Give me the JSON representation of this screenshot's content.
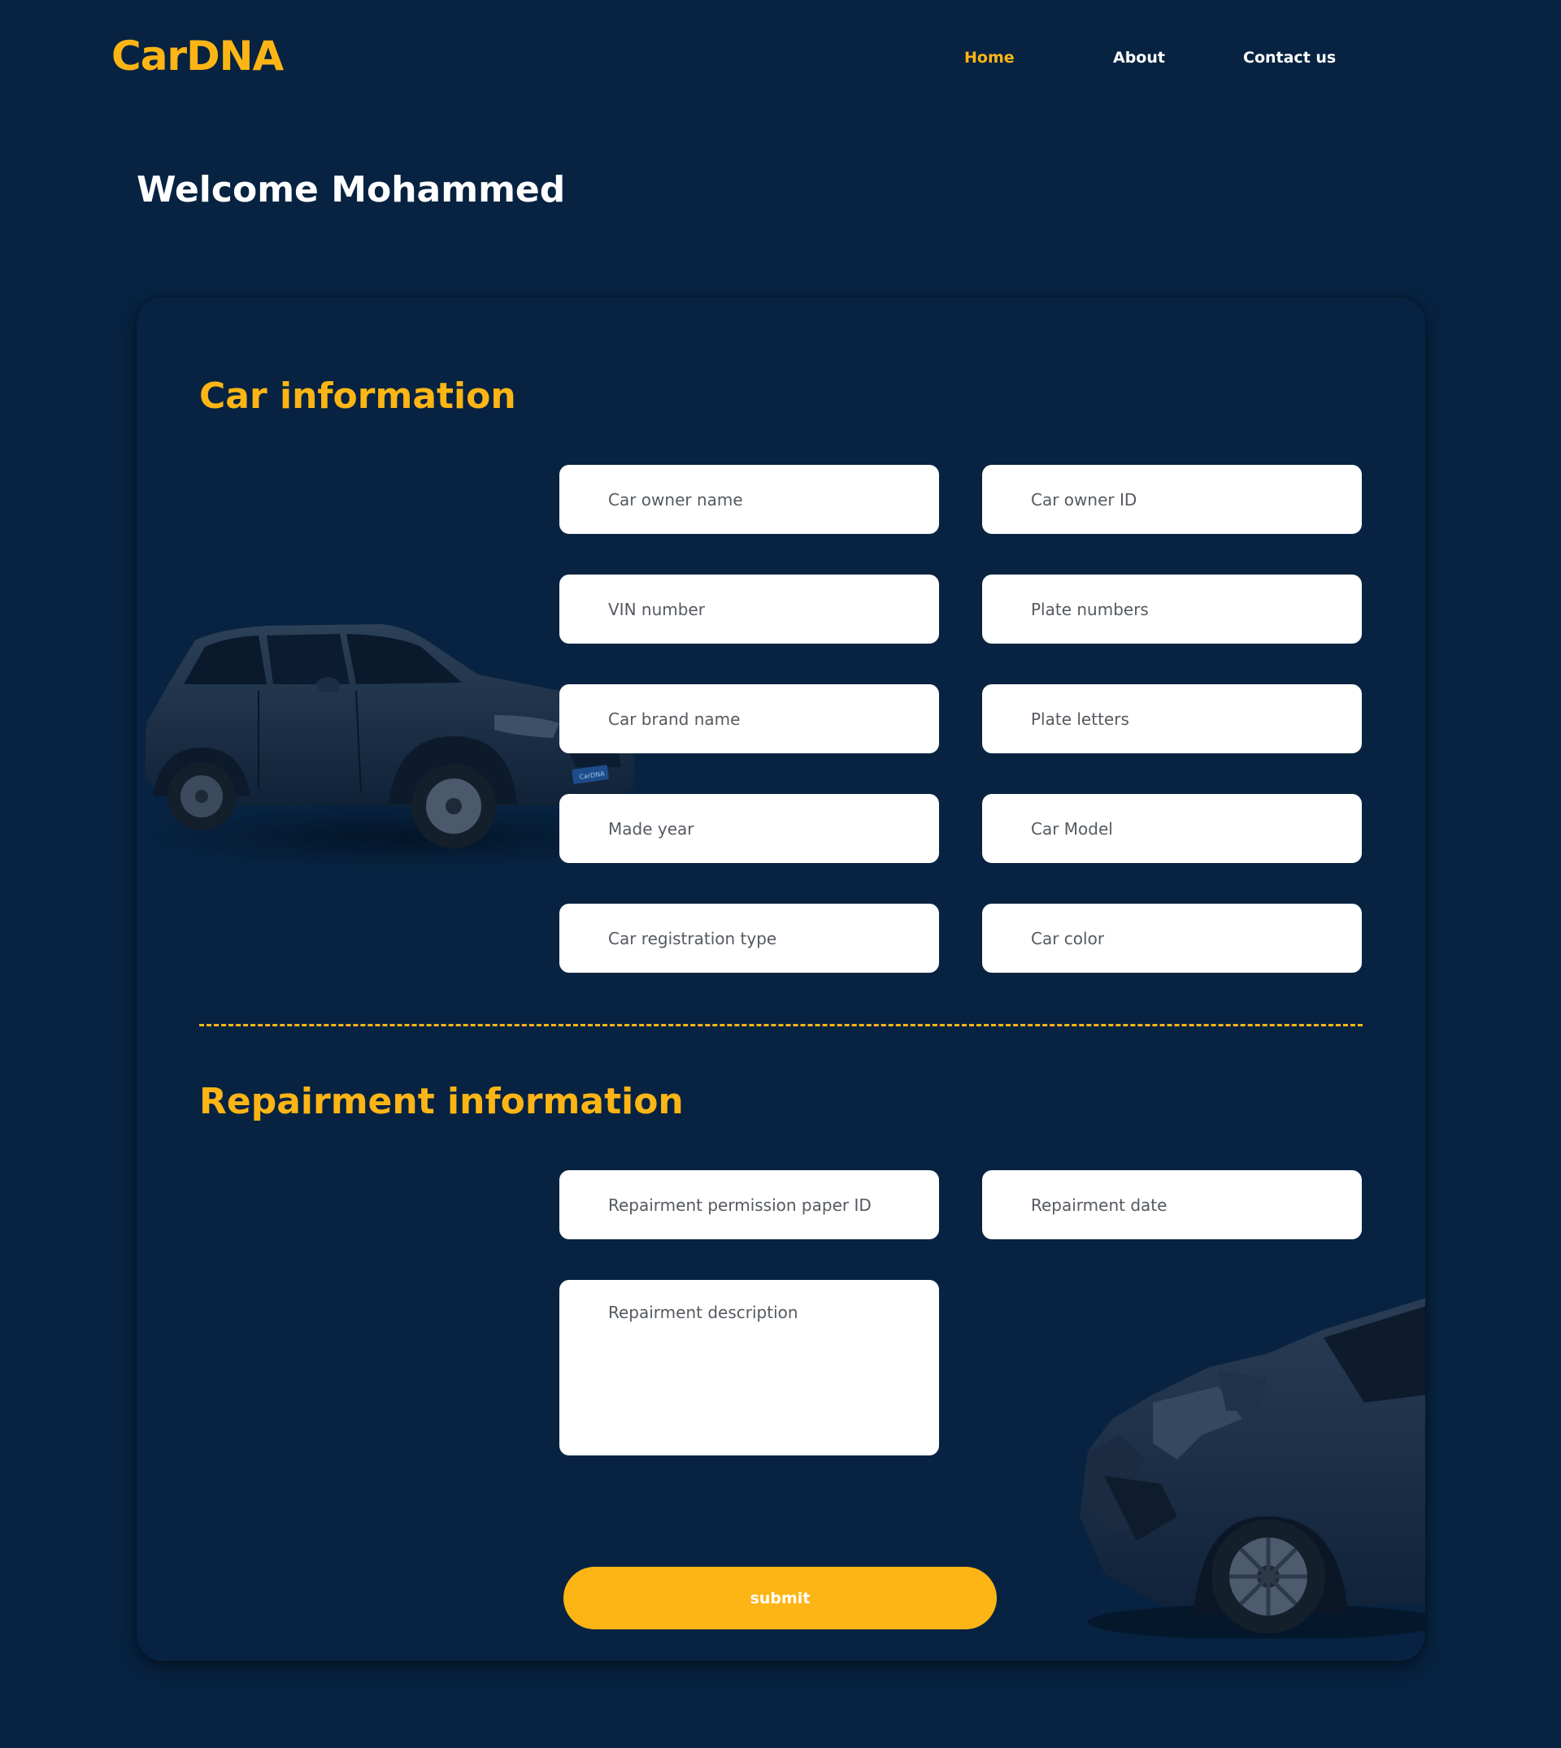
{
  "header": {
    "logo": "CarDNA",
    "nav": [
      {
        "label": "Home",
        "active": true
      },
      {
        "label": "About",
        "active": false
      },
      {
        "label": "Contact us",
        "active": false
      }
    ]
  },
  "welcome": "Welcome Mohammed",
  "car_info": {
    "title": "Car information",
    "fields": {
      "owner_name": "Car owner name",
      "owner_id": "Car owner ID",
      "vin": "VIN number",
      "plate_numbers": "Plate numbers",
      "brand_name": "Car brand name",
      "plate_letters": "Plate letters",
      "made_year": "Made year",
      "model": "Car Model",
      "registration_type": "Car registration type",
      "color": "Car color"
    }
  },
  "repair_info": {
    "title": "Repairment information",
    "fields": {
      "permission_id": "Repairment permission paper ID",
      "date": "Repairment date",
      "description": "Repairment description"
    }
  },
  "submit_label": "submit",
  "plate_text": "CarDNA",
  "colors": {
    "background": "#072341",
    "accent": "#FDB515",
    "field": "#ffffff"
  }
}
